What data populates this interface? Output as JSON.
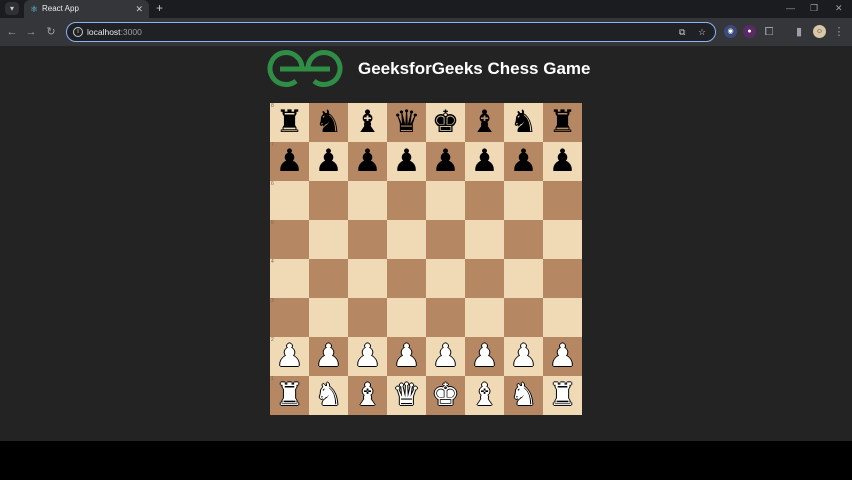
{
  "browser": {
    "tab_title": "React App",
    "url_host": "localhost",
    "url_port": ":3000"
  },
  "page": {
    "title": "GeeksforGeeks Chess Game"
  },
  "colors": {
    "light_square": "#f0d9b5",
    "dark_square": "#b58863",
    "logo_green": "#2f8d46",
    "page_bg": "#232323"
  },
  "board": {
    "rank_labels": [
      "8",
      "7",
      "6",
      "5",
      "4",
      "3",
      "2",
      "1"
    ],
    "ranks": [
      [
        "bR",
        "bN",
        "bB",
        "bQ",
        "bK",
        "bB",
        "bN",
        "bR"
      ],
      [
        "bP",
        "bP",
        "bP",
        "bP",
        "bP",
        "bP",
        "bP",
        "bP"
      ],
      [
        "",
        "",
        "",
        "",
        "",
        "",
        "",
        ""
      ],
      [
        "",
        "",
        "",
        "",
        "",
        "",
        "",
        ""
      ],
      [
        "",
        "",
        "",
        "",
        "",
        "",
        "",
        ""
      ],
      [
        "",
        "",
        "",
        "",
        "",
        "",
        "",
        ""
      ],
      [
        "wP",
        "wP",
        "wP",
        "wP",
        "wP",
        "wP",
        "wP",
        "wP"
      ],
      [
        "wR",
        "wN",
        "wB",
        "wQ",
        "wK",
        "wB",
        "wN",
        "wR"
      ]
    ]
  }
}
